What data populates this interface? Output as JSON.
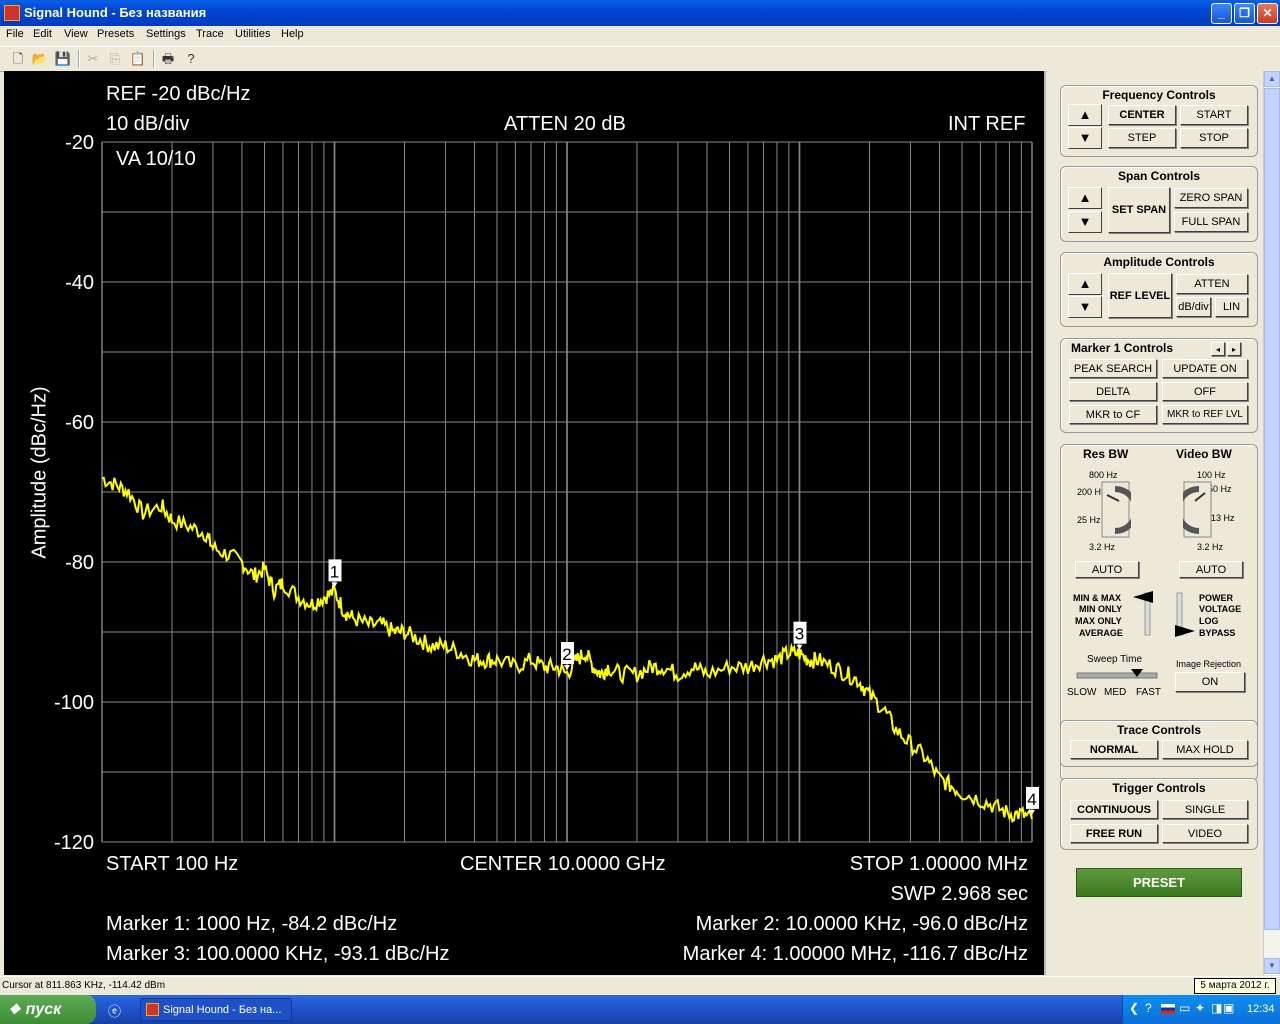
{
  "window": {
    "title": "Signal Hound - Без названия"
  },
  "menu": [
    "File",
    "Edit",
    "View",
    "Presets",
    "Settings",
    "Trace",
    "Utilities",
    "Help"
  ],
  "display": {
    "ref": "REF -20 dBc/Hz",
    "scale": "10 dB/div",
    "atten": "ATTEN 20 dB",
    "int_ref": "INT REF",
    "va": "VA 10/10",
    "start": "START 100 Hz",
    "center": "CENTER 10.0000 GHz",
    "stop": "STOP 1.00000 MHz",
    "sweep": "SWP 2.968 sec",
    "ylabel": "Amplitude (dBc/Hz)",
    "markers_text": [
      "Marker 1: 1000 Hz, -84.2 dBc/Hz",
      "Marker 2: 10.0000 KHz, -96.0 dBc/Hz",
      "Marker 3: 100.0000 KHz, -93.1 dBc/Hz",
      "Marker 4: 1.00000 MHz, -116.7 dBc/Hz"
    ]
  },
  "chart_data": {
    "type": "line",
    "x_scale": "log",
    "xlim": [
      100,
      1000000
    ],
    "ylim": [
      -120,
      -20
    ],
    "yticks": [
      -20,
      -40,
      -60,
      -80,
      -100,
      -120
    ],
    "trace_color": "#ffff00",
    "series": [
      {
        "x": [
          100,
          115,
          130,
          150,
          180,
          200,
          240,
          280,
          300,
          350,
          400,
          450,
          500,
          550,
          600,
          700,
          800,
          900,
          1000,
          1100,
          1200,
          1400,
          1600,
          1800,
          2000,
          2300,
          2600,
          3000,
          3500,
          4000,
          4500,
          5000,
          6000,
          7000,
          8000,
          9000,
          10000,
          11000,
          12000,
          13000,
          14000,
          15000,
          17000,
          20000,
          23000,
          26000,
          30000,
          35000,
          40000,
          50000,
          60000,
          70000,
          80000,
          90000,
          100000,
          110000,
          120000,
          140000,
          160000,
          180000,
          200000,
          230000,
          260000,
          300000,
          350000,
          400000,
          450000,
          500000,
          600000,
          700000,
          800000,
          900000,
          1000000
        ],
        "y": [
          -68,
          -69,
          -70,
          -73,
          -72,
          -74,
          -75,
          -76,
          -78,
          -79,
          -80,
          -82,
          -81,
          -84,
          -83,
          -85,
          -86,
          -85,
          -84.2,
          -87,
          -88,
          -89,
          -89,
          -90,
          -90,
          -91,
          -92,
          -92,
          -93,
          -94,
          -94,
          -94,
          -95,
          -94,
          -95,
          -95,
          -96,
          -94,
          -93,
          -95,
          -96,
          -95,
          -96,
          -96,
          -95,
          -95,
          -96,
          -95,
          -96,
          -95,
          -95,
          -94,
          -94,
          -93,
          -93.1,
          -94,
          -94,
          -95,
          -96,
          -97,
          -99,
          -101,
          -104,
          -106,
          -108,
          -111,
          -112,
          -113,
          -114,
          -115,
          -116,
          -116,
          -116.7
        ]
      }
    ],
    "markers": [
      {
        "label": "1",
        "x": 1000,
        "y": -84.2
      },
      {
        "label": "2",
        "x": 10000,
        "y": -96.0
      },
      {
        "label": "3",
        "x": 100000,
        "y": -93.1
      },
      {
        "label": "4",
        "x": 1000000,
        "y": -116.7
      }
    ]
  },
  "panel": {
    "freq": {
      "title": "Frequency Controls",
      "center": "CENTER",
      "start": "START",
      "step": "STEP",
      "stop": "STOP"
    },
    "span": {
      "title": "Span Controls",
      "set_span": "SET SPAN",
      "zero_span": "ZERO SPAN",
      "full_span": "FULL SPAN"
    },
    "amp": {
      "title": "Amplitude Controls",
      "ref_level": "REF LEVEL",
      "atten": "ATTEN",
      "dbdiv": "dB/div",
      "lin": "LIN"
    },
    "marker": {
      "title": "Marker 1 Controls",
      "peak": "PEAK SEARCH",
      "update": "UPDATE ON",
      "delta": "DELTA",
      "off": "OFF",
      "mkr_cf": "MKR to CF",
      "mkr_ref": "MKR to REF LVL"
    },
    "bw": {
      "res_title": "Res BW",
      "video_title": "Video BW",
      "res_ticks": [
        "800 Hz",
        "200 Hz",
        "25 Hz",
        "3.2 Hz"
      ],
      "video_ticks": [
        "100 Hz",
        "50 Hz",
        "13 Hz",
        "3.2 Hz"
      ],
      "res_auto": "AUTO",
      "video_auto": "AUTO",
      "detector": [
        "MIN & MAX",
        "MIN ONLY",
        "MAX ONLY",
        "AVERAGE"
      ],
      "scale": [
        "POWER",
        "VOLTAGE",
        "LOG",
        "BYPASS"
      ],
      "sweep_title": "Sweep Time",
      "sweep_labels": [
        "SLOW",
        "MED",
        "FAST"
      ],
      "image_title": "Image Rejection",
      "image_btn": "ON"
    },
    "trace": {
      "title": "Trace Controls",
      "normal": "NORMAL",
      "maxhold": "MAX HOLD"
    },
    "trigger": {
      "title": "Trigger Controls",
      "continuous": "CONTINUOUS",
      "single": "SINGLE",
      "freerun": "FREE RUN",
      "video": "VIDEO"
    },
    "preset": "PRESET"
  },
  "status": {
    "cursor": "Cursor at 811.863 KHz, -114.42 dBm",
    "date": "5 марта 2012 г."
  },
  "taskbar": {
    "start": "пуск",
    "task": "Signal Hound - Без на...",
    "time": "12:34"
  }
}
